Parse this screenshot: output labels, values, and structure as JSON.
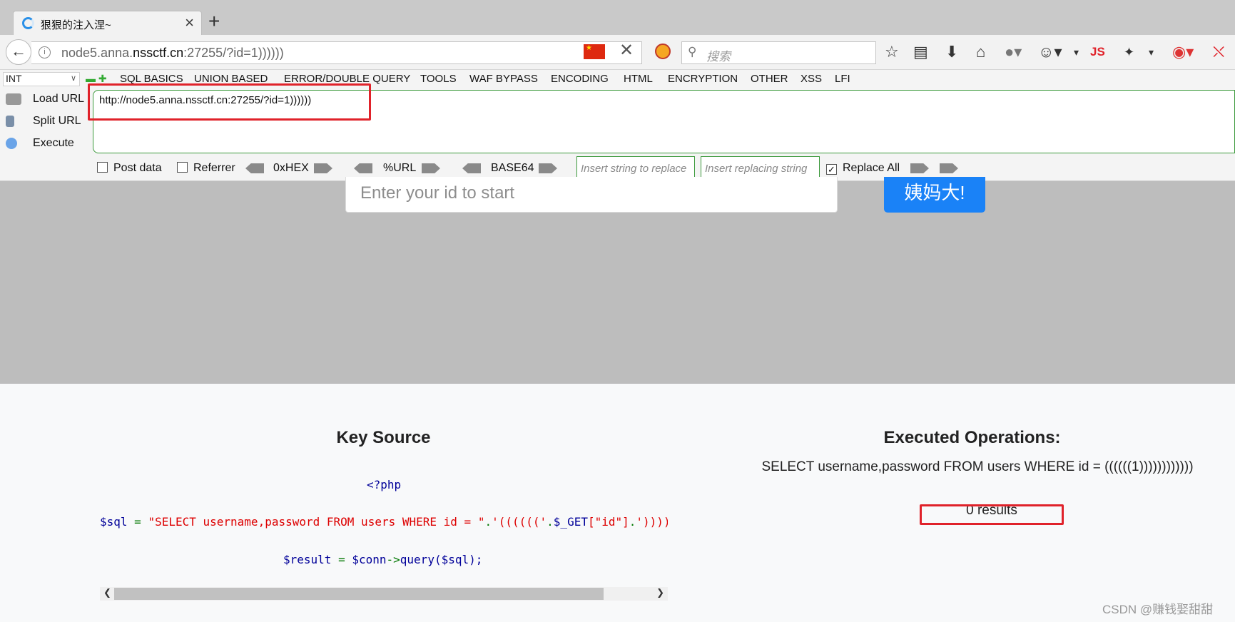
{
  "tab": {
    "title": "狠狠的注入涅~",
    "close": "×",
    "new_tab": "+"
  },
  "nav": {
    "url_host_prefix": "node5.anna.",
    "url_host_main": "nssctf.cn",
    "url_rest": ":27255/?id=1))))))",
    "search_placeholder": "搜索",
    "js_label": "JS"
  },
  "hackbar": {
    "type_select": "INT",
    "menus": [
      "SQL BASICS",
      "UNION BASED",
      "ERROR/DOUBLE QUERY",
      "TOOLS",
      "WAF BYPASS",
      "ENCODING",
      "HTML",
      "ENCRYPTION",
      "OTHER",
      "XSS",
      "LFI"
    ],
    "side": [
      "Load URL",
      "Split URL",
      "Execute"
    ],
    "url_value": "http://node5.anna.nssctf.cn:27255/?id=1))))))",
    "post_data": "Post data",
    "referrer": "Referrer",
    "enc": [
      "0xHEX",
      "%URL",
      "BASE64"
    ],
    "replace_from_placeholder": "Insert string to replace",
    "replace_to_placeholder": "Insert replacing string",
    "replace_all": "Replace All"
  },
  "page": {
    "id_placeholder": "Enter your id to start",
    "submit_label": "姨妈大!",
    "key_source_heading": "Key Source",
    "php_open": "<?php",
    "code_var_sql": "$sql",
    "code_eq": " = ",
    "code_string": "\"SELECT username,password FROM users WHERE id = \"",
    "code_concat1": ".",
    "code_paren_open": "'(((((('",
    "code_concat2": ".",
    "code_get": "$_GET",
    "code_idx": "[\"id\"]",
    "code_concat3": ".",
    "code_paren_close": "'))))",
    "code_var_result": "$result",
    "code_eq2": " = ",
    "code_conn": "$conn",
    "code_arrow": "->",
    "code_query": "query",
    "code_args": "($sql);",
    "executed_heading": "Executed Operations:",
    "executed_sql": "SELECT username,password FROM users WHERE id = ((((((1))))))))))))",
    "results_text": "0 results"
  },
  "watermark": "CSDN @赚钱娶甜甜"
}
